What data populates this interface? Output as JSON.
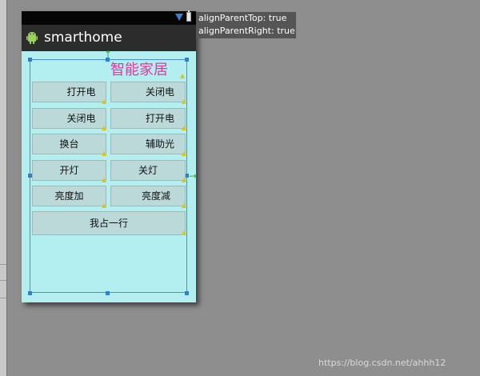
{
  "app": {
    "title": "smarthome"
  },
  "tooltip": {
    "line1": "alignParentTop: true",
    "line2": "alignParentRight: true"
  },
  "heading": "智能家居",
  "buttons": [
    "打开电",
    "关闭电",
    "关闭电",
    "打开电",
    "换台",
    "辅助光",
    "开灯",
    "关灯",
    "亮度加",
    "亮度减",
    "我占一行"
  ],
  "watermark": "https://blog.csdn.net/ahhh12",
  "colors": {
    "screen_bg": "#b3eef0",
    "heading": "#e0389b",
    "selection": "#4a8fd8",
    "editor_bg": "#8e8e8e"
  },
  "icons": [
    "android-icon",
    "wifi-icon",
    "battery-icon",
    "warning-icon",
    "green-arrow-icon"
  ]
}
